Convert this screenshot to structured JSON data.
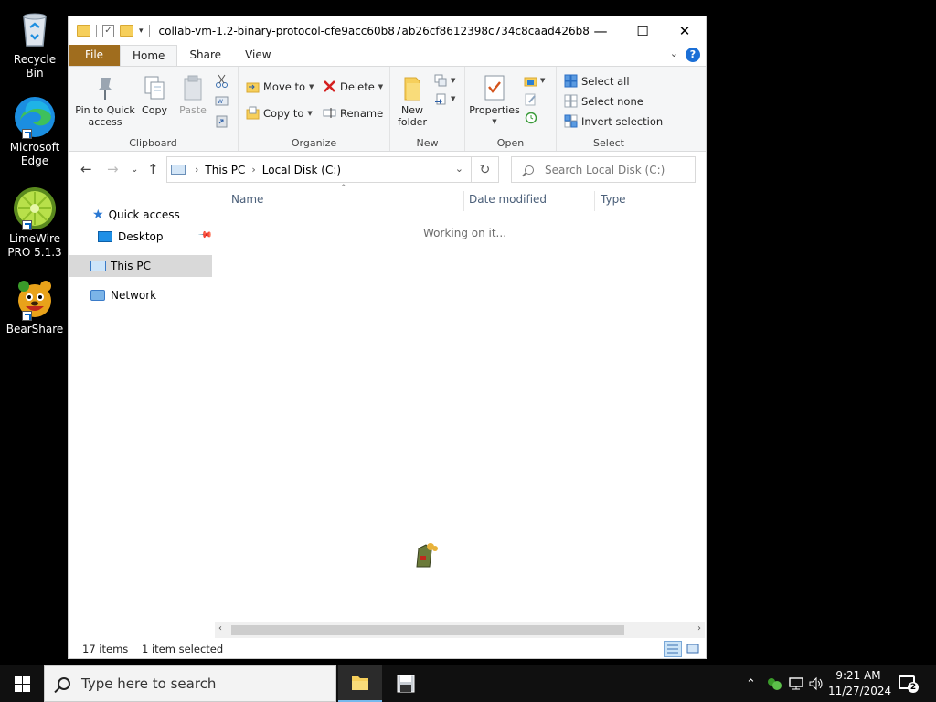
{
  "desktop": {
    "icons": [
      {
        "label": "Recycle Bin",
        "icon": "recycle-bin-icon"
      },
      {
        "label": "Microsoft Edge",
        "icon": "edge-icon"
      },
      {
        "label": "LimeWire PRO 5.1.3",
        "icon": "limewire-icon"
      },
      {
        "label": "BearShare",
        "icon": "bearshare-icon"
      }
    ]
  },
  "window": {
    "title": "collab-vm-1.2-binary-protocol-cfe9acc60b87ab26cf8612398c734c8caad426b8",
    "tabs": {
      "file": "File",
      "home": "Home",
      "share": "Share",
      "view": "View"
    },
    "ribbon": {
      "clipboard": {
        "label": "Clipboard",
        "pin": "Pin to Quick access",
        "copy": "Copy",
        "paste": "Paste"
      },
      "organize": {
        "label": "Organize",
        "move_to": "Move to",
        "copy_to": "Copy to",
        "delete": "Delete",
        "rename": "Rename"
      },
      "new": {
        "label": "New",
        "new_folder": "New folder"
      },
      "open": {
        "label": "Open",
        "properties": "Properties"
      },
      "select": {
        "label": "Select",
        "select_all": "Select all",
        "select_none": "Select none",
        "invert": "Invert selection"
      }
    },
    "address": {
      "crumbs": [
        "This PC",
        "Local Disk (C:)"
      ],
      "search_placeholder": "Search Local Disk (C:)"
    },
    "nav_pane": {
      "quick_access": "Quick access",
      "desktop": "Desktop",
      "this_pc": "This PC",
      "network": "Network"
    },
    "columns": {
      "name": "Name",
      "date_modified": "Date modified",
      "type": "Type"
    },
    "content_status": "Working on it...",
    "status_bar": {
      "items": "17 items",
      "selected": "1 item selected"
    }
  },
  "taskbar": {
    "search_placeholder": "Type here to search",
    "time": "9:21 AM",
    "date": "11/27/2024",
    "notifications": "2"
  },
  "colors": {
    "file_tab": "#a06d1e",
    "ribbon_bg": "#f5f6f7",
    "selection": "#d9d9d9",
    "taskbar": "#101010"
  }
}
